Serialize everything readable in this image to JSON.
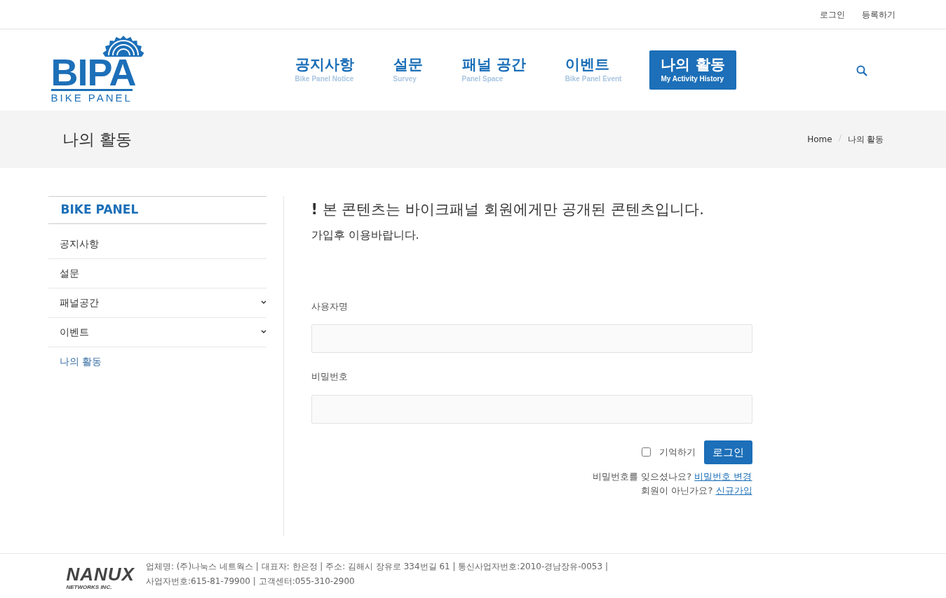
{
  "top_links": [
    "로그인",
    "등록하기"
  ],
  "logo": {
    "mark": "BIPA",
    "subtitle": "BIKE PANEL"
  },
  "nav": [
    {
      "label": "공지사항",
      "sub": "Bike Panel Notice",
      "selected": false
    },
    {
      "label": "설문",
      "sub": "Survey",
      "selected": false
    },
    {
      "label": "패널 공간",
      "sub": "Panel Space",
      "selected": false
    },
    {
      "label": "이벤트",
      "sub": "Bike Panel Event",
      "selected": false
    },
    {
      "label": "나의 활동",
      "sub": "My Activity History",
      "selected": true
    }
  ],
  "page_title": "나의 활동",
  "breadcrumb": [
    "Home",
    "나의 활동"
  ],
  "sidebar": {
    "title": "BIKE PANEL",
    "items": [
      {
        "label": "공지사항",
        "expandable": false,
        "selected": false
      },
      {
        "label": "설문",
        "expandable": false,
        "selected": false
      },
      {
        "label": "패널공간",
        "expandable": true,
        "selected": false
      },
      {
        "label": "이벤트",
        "expandable": true,
        "selected": false
      },
      {
        "label": "나의 활동",
        "expandable": false,
        "selected": true
      }
    ]
  },
  "notice": {
    "mark": "!",
    "headline": "본 콘텐츠는 바이크패널 회원에게만 공개된 콘텐츠입니다.",
    "subline": "가입후 이용바랍니다."
  },
  "form": {
    "fields": [
      {
        "label": "사용자명"
      },
      {
        "label": "비밀번호"
      }
    ],
    "remember": {
      "label": "기억하기",
      "checked": false
    },
    "submit": "로그인",
    "help": [
      {
        "text": "비밀번호를 잊으셨나요?",
        "link": "비밀번호 변경"
      },
      {
        "text": "회원이 아닌가요?",
        "link": "신규가입"
      }
    ]
  },
  "footer": {
    "logo": "NANUX",
    "logo_sub": "NETWORKS INC.",
    "lines": [
      "업체명: (주)나눅스 네트웍스 | 대표자: 한은정 | 주소: 김해시 장유로 334번길 61 | 통신사업자번호:2010-경남장유-0053 |",
      "사업자번호:615-81-79900 | 고객센터:055-310-2900"
    ]
  }
}
